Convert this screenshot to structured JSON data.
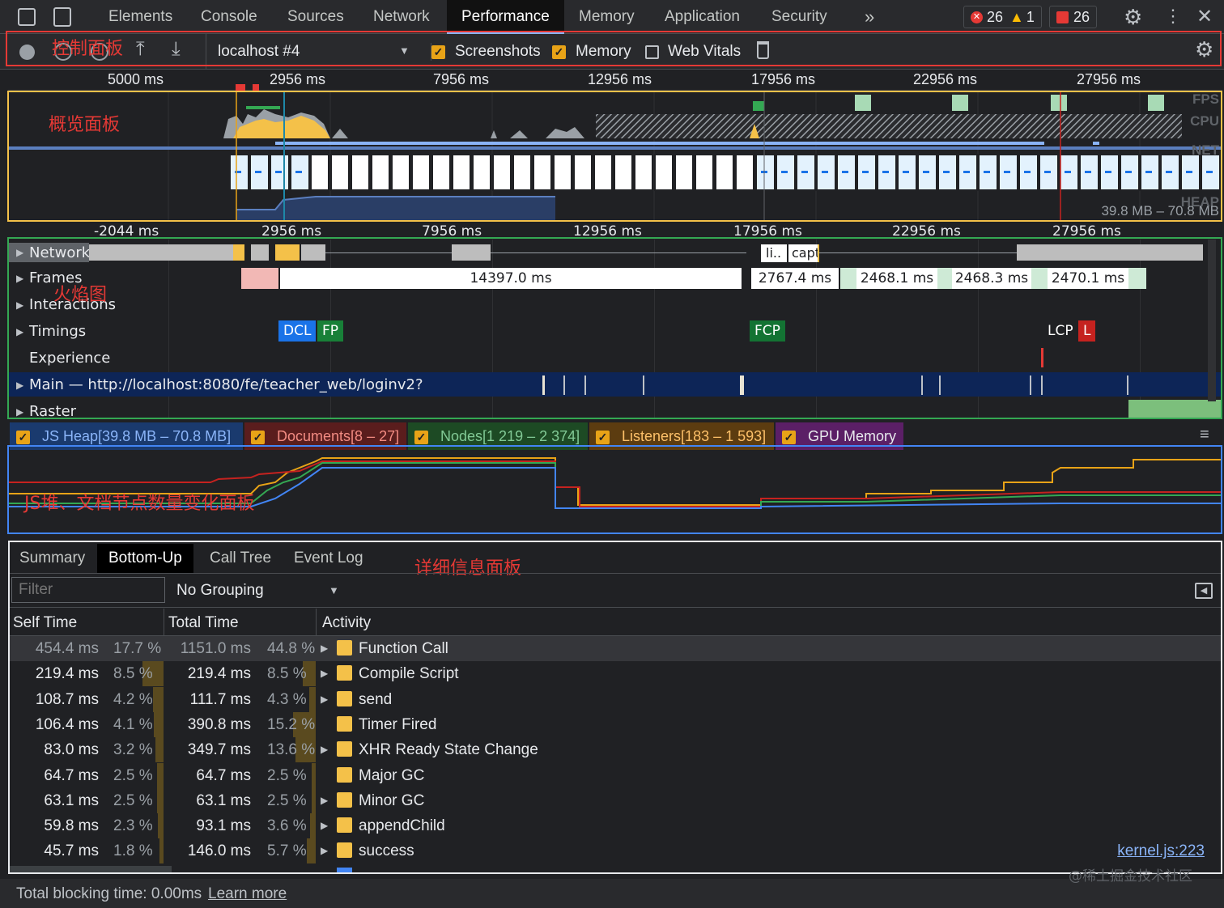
{
  "tabs": [
    "Elements",
    "Console",
    "Sources",
    "Network",
    "Performance",
    "Memory",
    "Application",
    "Security"
  ],
  "more_tabs": "»",
  "badges": {
    "errors": "26",
    "warnings": "1",
    "issues": "26"
  },
  "control": {
    "profile_select": "localhost #4",
    "screenshots_label": "Screenshots",
    "screenshots_checked": true,
    "memory_label": "Memory",
    "memory_checked": true,
    "web_vitals_label": "Web Vitals",
    "web_vitals_checked": false
  },
  "annotations": {
    "control": "控制面板",
    "overview": "概览面板",
    "flame": "火焰图",
    "heap": "JS堆、文档节点数量变化面板",
    "details": "详细信息面板"
  },
  "top_ruler": [
    "5000 ms",
    "2956 ms",
    "7956 ms",
    "12956 ms",
    "17956 ms",
    "22956 ms",
    "27956 ms"
  ],
  "overview_labels": {
    "fps": "FPS",
    "cpu": "CPU",
    "net": "NET",
    "heap": "HEAP",
    "heap_range": "39.8 MB – 70.8 MB"
  },
  "flame_ruler": [
    "-2044 ms",
    "2956 ms",
    "7956 ms",
    "12956 ms",
    "17956 ms",
    "22956 ms",
    "27956 ms"
  ],
  "tracks": {
    "network": "Network",
    "frames": "Frames",
    "interactions": "Interactions",
    "timings": "Timings",
    "experience": "Experience",
    "main": "Main — http://localhost:8080/fe/teacher_web/loginv2?",
    "raster": "Raster"
  },
  "network_items": [
    "li..",
    "capt"
  ],
  "frames": [
    "14397.0 ms",
    "2767.4 ms",
    "2468.1 ms",
    "2468.3 ms",
    "2470.1 ms"
  ],
  "timings": {
    "dcl": "DCL",
    "fp": "FP",
    "fcp": "FCP",
    "lcp": "LCP",
    "l": "L"
  },
  "legend": [
    {
      "label": "JS Heap[39.8 MB – 70.8 MB]",
      "color": "#1a3a6e",
      "text": "#8ab4f8"
    },
    {
      "label": "Documents[8 – 27]",
      "color": "#5a1d1d",
      "text": "#f28b82"
    },
    {
      "label": "Nodes[1 219 – 2 374]",
      "color": "#1d4a24",
      "text": "#81c995"
    },
    {
      "label": "Listeners[183 – 1 593]",
      "color": "#5c3c10",
      "text": "#fdc069"
    },
    {
      "label": "GPU Memory",
      "color": "#5b1f66",
      "text": "#e8eaed"
    }
  ],
  "bottom_tabs": [
    "Summary",
    "Bottom-Up",
    "Call Tree",
    "Event Log"
  ],
  "filter_placeholder": "Filter",
  "grouping": "No Grouping",
  "columns": {
    "self": "Self Time",
    "total": "Total Time",
    "activity": "Activity"
  },
  "rows": [
    {
      "self": "454.4 ms",
      "self_pct": "17.7 %",
      "total": "1151.0 ms",
      "total_pct": "44.8 %",
      "name": "Function Call",
      "expand": true,
      "self_frac": 0.177,
      "total_frac": 0.448
    },
    {
      "self": "219.4 ms",
      "self_pct": "8.5 %",
      "total": "219.4 ms",
      "total_pct": "8.5 %",
      "name": "Compile Script",
      "expand": true,
      "self_frac": 0.085,
      "total_frac": 0.085
    },
    {
      "self": "108.7 ms",
      "self_pct": "4.2 %",
      "total": "111.7 ms",
      "total_pct": "4.3 %",
      "name": "send",
      "expand": true,
      "self_frac": 0.042,
      "total_frac": 0.043
    },
    {
      "self": "106.4 ms",
      "self_pct": "4.1 %",
      "total": "390.8 ms",
      "total_pct": "15.2 %",
      "name": "Timer Fired",
      "expand": false,
      "self_frac": 0.041,
      "total_frac": 0.152
    },
    {
      "self": "83.0 ms",
      "self_pct": "3.2 %",
      "total": "349.7 ms",
      "total_pct": "13.6 %",
      "name": "XHR Ready State Change",
      "expand": true,
      "self_frac": 0.032,
      "total_frac": 0.136
    },
    {
      "self": "64.7 ms",
      "self_pct": "2.5 %",
      "total": "64.7 ms",
      "total_pct": "2.5 %",
      "name": "Major GC",
      "expand": false,
      "self_frac": 0.025,
      "total_frac": 0.025
    },
    {
      "self": "63.1 ms",
      "self_pct": "2.5 %",
      "total": "63.1 ms",
      "total_pct": "2.5 %",
      "name": "Minor GC",
      "expand": true,
      "self_frac": 0.025,
      "total_frac": 0.025
    },
    {
      "self": "59.8 ms",
      "self_pct": "2.3 %",
      "total": "93.1 ms",
      "total_pct": "3.6 %",
      "name": "appendChild",
      "expand": true,
      "self_frac": 0.023,
      "total_frac": 0.036
    },
    {
      "self": "45.7 ms",
      "self_pct": "1.8 %",
      "total": "146.0 ms",
      "total_pct": "5.7 %",
      "name": "success",
      "expand": true,
      "self_frac": 0.018,
      "total_frac": 0.057,
      "link": "kernel.js:223"
    }
  ],
  "status": {
    "text": "Total blocking time: 0.00ms",
    "link": "Learn more"
  },
  "watermark": "@稀土掘金技术社区"
}
